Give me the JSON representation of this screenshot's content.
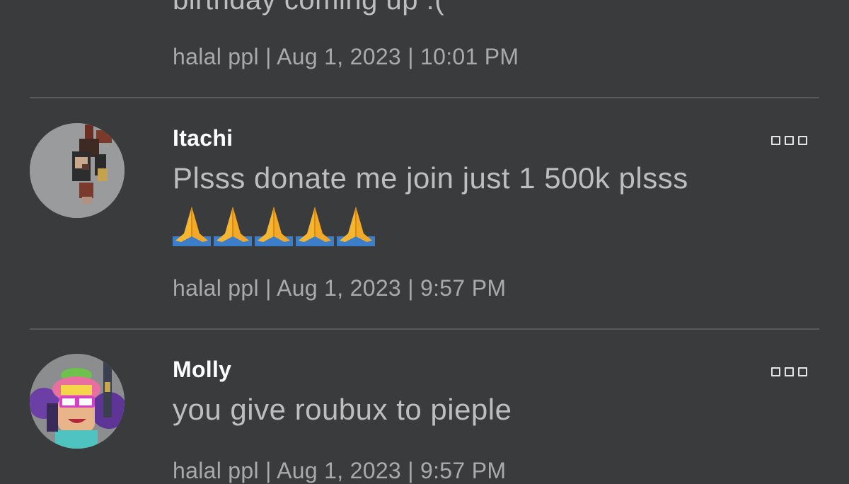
{
  "comments": [
    {
      "body_partial": "birthday coming up :(",
      "meta": "halal ppl | Aug 1, 2023 | 10:01 PM"
    },
    {
      "username": "Itachi",
      "body": "Plsss donate me join just 1 500k plsss",
      "body_emoji": "🙏🙏🙏🙏🙏",
      "meta": "halal ppl | Aug 1, 2023 | 9:57 PM"
    },
    {
      "username": "Molly",
      "body": "you give roubux to pieple",
      "meta": "halal ppl | Aug 1, 2023 | 9:57 PM"
    }
  ],
  "icons": {
    "more": "more-options-icon",
    "emoji": "folded-hands-emoji"
  },
  "colors": {
    "background": "#393b3d",
    "username": "#ffffff",
    "body_text": "#bdbebe",
    "meta_text": "#a9aaab",
    "divider": "#58595b"
  }
}
